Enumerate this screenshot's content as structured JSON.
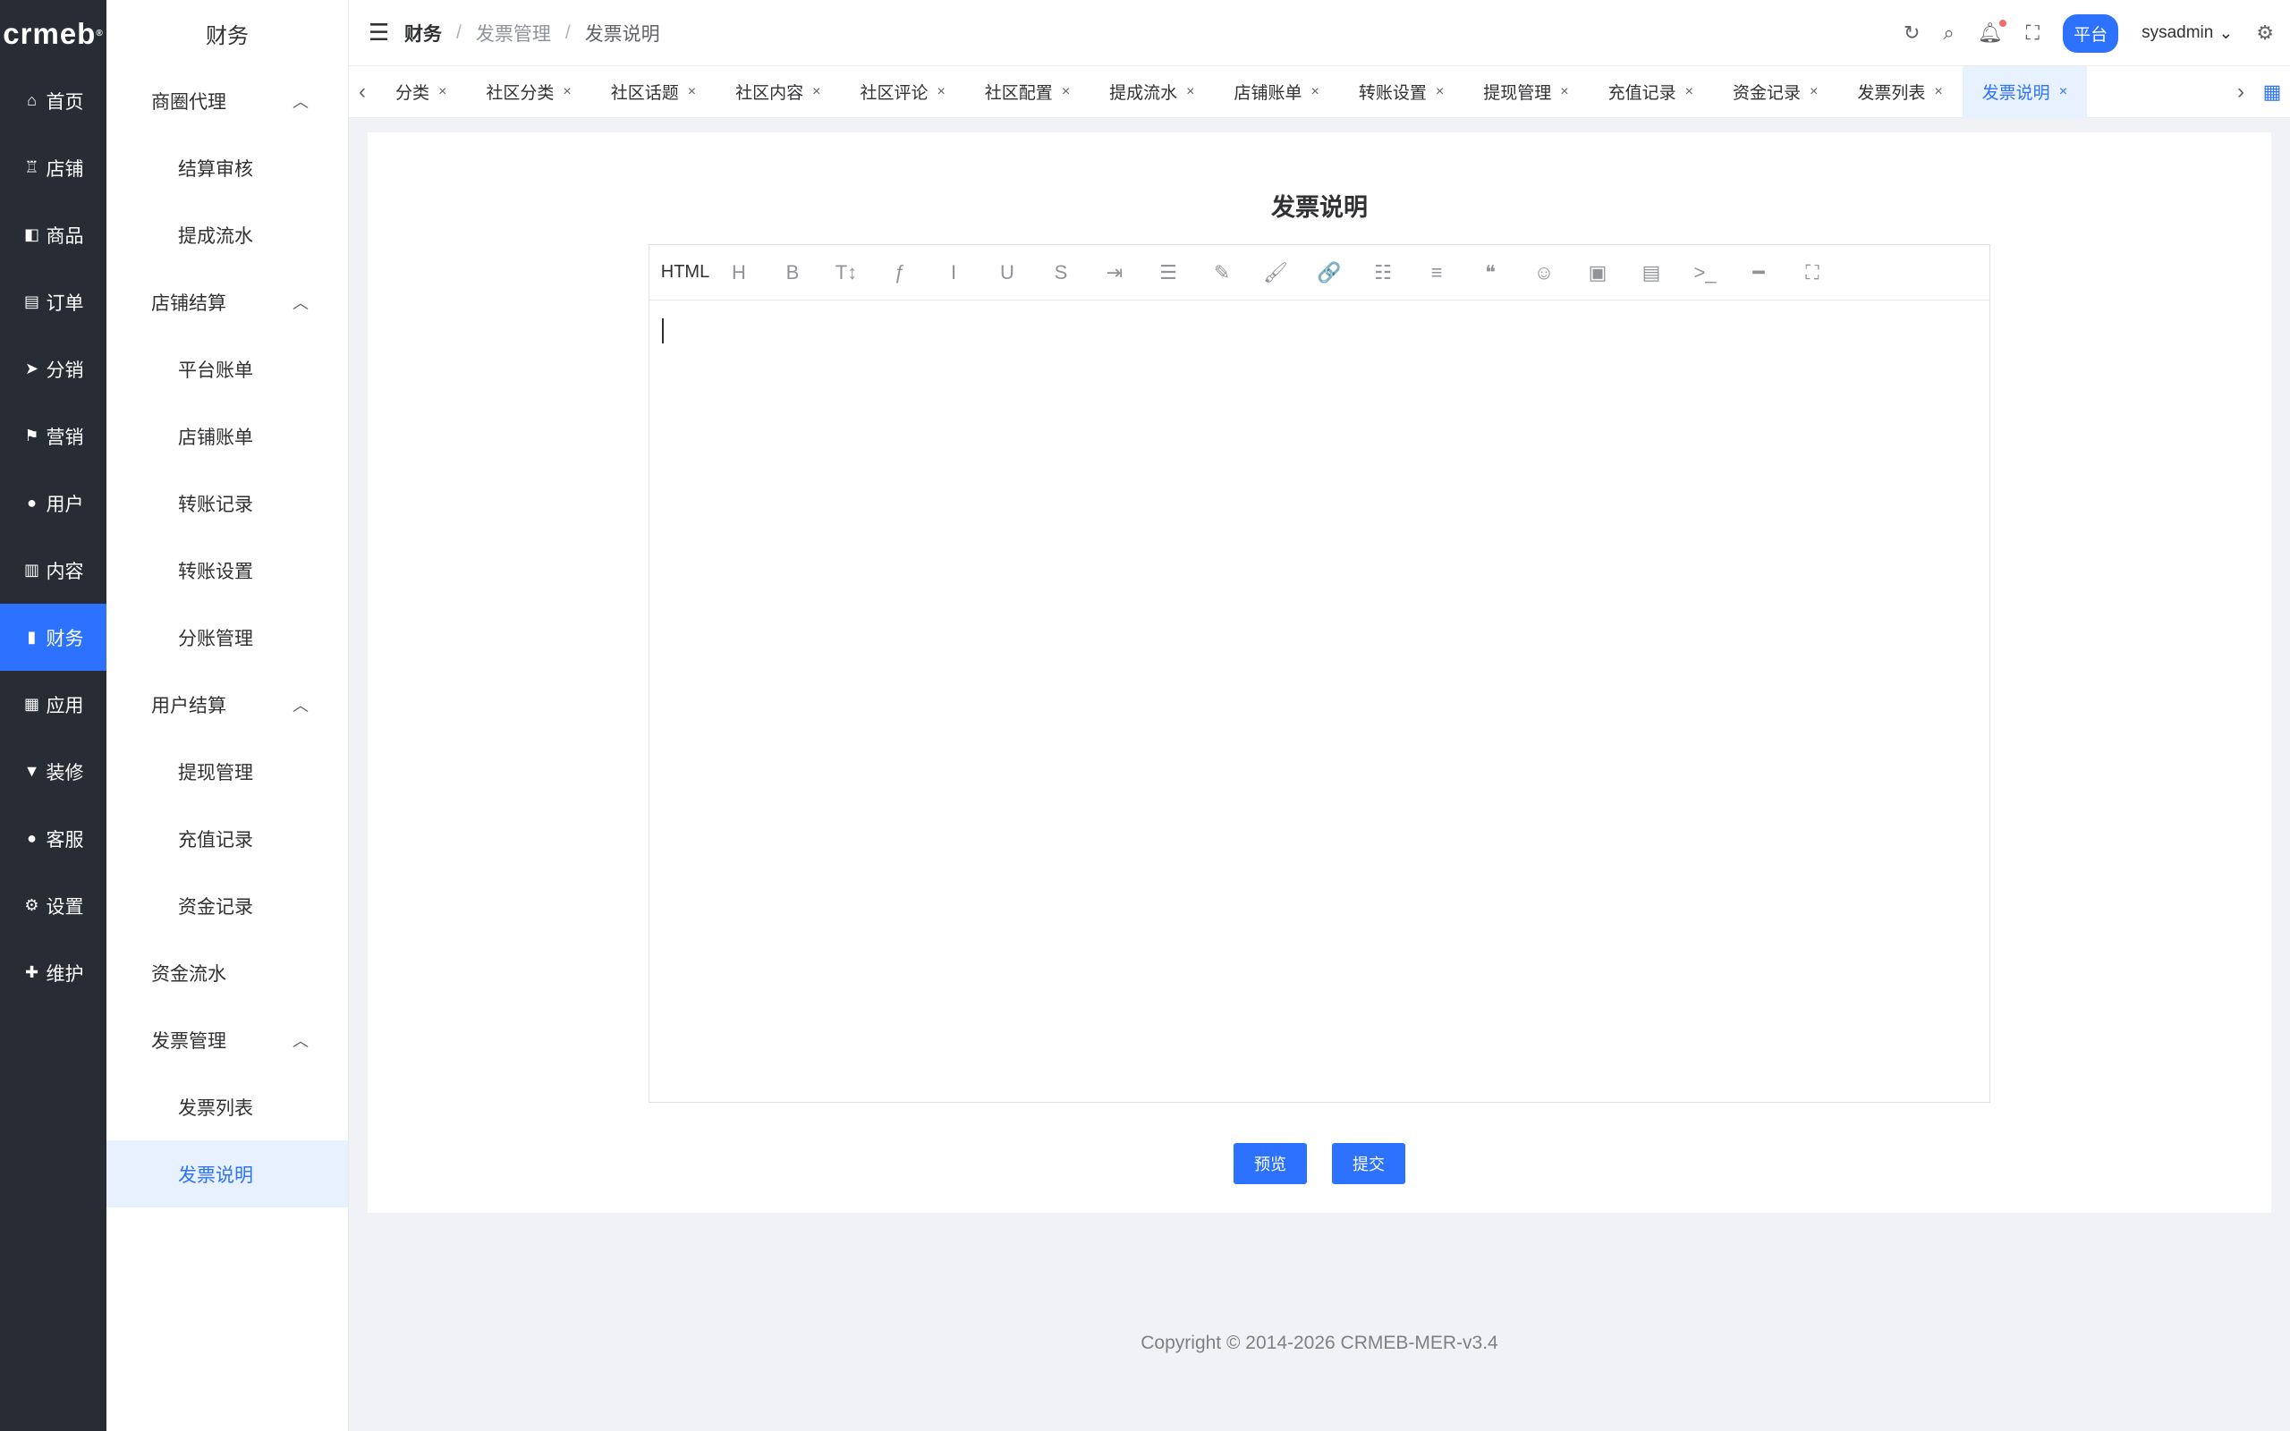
{
  "brand": {
    "logo_text": "crmeb"
  },
  "primary_nav": [
    {
      "label": "首页",
      "icon": "home-icon",
      "glyph": "⌂",
      "active": false
    },
    {
      "label": "店铺",
      "icon": "store-icon",
      "glyph": "♖",
      "active": false
    },
    {
      "label": "商品",
      "icon": "bag-icon",
      "glyph": "◧",
      "active": false
    },
    {
      "label": "订单",
      "icon": "clipboard-icon",
      "glyph": "▤",
      "active": false
    },
    {
      "label": "分销",
      "icon": "send-icon",
      "glyph": "➤",
      "active": false
    },
    {
      "label": "营销",
      "icon": "flag-icon",
      "glyph": "⚑",
      "active": false
    },
    {
      "label": "用户",
      "icon": "user-icon",
      "glyph": "●",
      "active": false
    },
    {
      "label": "内容",
      "icon": "book-icon",
      "glyph": "▥",
      "active": false
    },
    {
      "label": "财务",
      "icon": "chart-icon",
      "glyph": "▮",
      "active": true
    },
    {
      "label": "应用",
      "icon": "grid-icon",
      "glyph": "▦",
      "active": false
    },
    {
      "label": "装修",
      "icon": "brush-icon",
      "glyph": "▼",
      "active": false
    },
    {
      "label": "客服",
      "icon": "headset-icon",
      "glyph": "●",
      "active": false
    },
    {
      "label": "设置",
      "icon": "gear-icon",
      "glyph": "⚙",
      "active": false
    },
    {
      "label": "维护",
      "icon": "wrench-icon",
      "glyph": "✚",
      "active": false
    }
  ],
  "secondary_nav": {
    "title": "财务",
    "g1": {
      "label": "商圈代理"
    },
    "g1_items": [
      "结算审核",
      "提成流水"
    ],
    "g2": {
      "label": "店铺结算"
    },
    "g2_items": [
      "平台账单",
      "店铺账单",
      "转账记录",
      "转账设置",
      "分账管理"
    ],
    "g3": {
      "label": "用户结算"
    },
    "g3_items": [
      "提现管理",
      "充值记录",
      "资金记录"
    ],
    "g4": {
      "label": "资金流水"
    },
    "g5": {
      "label": "发票管理"
    },
    "g5_items": [
      "发票列表",
      "发票说明"
    ]
  },
  "header": {
    "breadcrumb": [
      "财务",
      "发票管理",
      "发票说明"
    ],
    "sep": "/",
    "platform_label": "平台",
    "username": "sysadmin"
  },
  "tabs": [
    {
      "label": "分类",
      "active": false
    },
    {
      "label": "社区分类",
      "active": false
    },
    {
      "label": "社区话题",
      "active": false
    },
    {
      "label": "社区内容",
      "active": false
    },
    {
      "label": "社区评论",
      "active": false
    },
    {
      "label": "社区配置",
      "active": false
    },
    {
      "label": "提成流水",
      "active": false
    },
    {
      "label": "店铺账单",
      "active": false
    },
    {
      "label": "转账设置",
      "active": false
    },
    {
      "label": "提现管理",
      "active": false
    },
    {
      "label": "充值记录",
      "active": false
    },
    {
      "label": "资金记录",
      "active": false
    },
    {
      "label": "发票列表",
      "active": false
    },
    {
      "label": "发票说明",
      "active": true
    }
  ],
  "main": {
    "title": "发票说明",
    "editor": {
      "toolbar": [
        {
          "name": "html-toggle",
          "glyph": "HTML"
        },
        {
          "name": "heading-icon",
          "glyph": "H"
        },
        {
          "name": "bold-icon",
          "glyph": "B"
        },
        {
          "name": "font-size-icon",
          "glyph": "T↕"
        },
        {
          "name": "font-family-icon",
          "glyph": "ƒ"
        },
        {
          "name": "italic-icon",
          "glyph": "I"
        },
        {
          "name": "underline-icon",
          "glyph": "U"
        },
        {
          "name": "strikethrough-icon",
          "glyph": "S"
        },
        {
          "name": "indent-icon",
          "glyph": "⇥"
        },
        {
          "name": "line-height-icon",
          "glyph": "☰"
        },
        {
          "name": "text-color-icon",
          "glyph": "✎"
        },
        {
          "name": "bg-color-icon",
          "glyph": "🖌"
        },
        {
          "name": "link-icon",
          "glyph": "🔗"
        },
        {
          "name": "list-icon",
          "glyph": "☷"
        },
        {
          "name": "align-icon",
          "glyph": "≡"
        },
        {
          "name": "quote-icon",
          "glyph": "❝"
        },
        {
          "name": "emoji-icon",
          "glyph": "☺"
        },
        {
          "name": "image-icon",
          "glyph": "▣"
        },
        {
          "name": "video-icon",
          "glyph": "▤"
        },
        {
          "name": "code-icon",
          "glyph": ">_"
        },
        {
          "name": "divider-icon",
          "glyph": "━"
        },
        {
          "name": "fullscreen-icon",
          "glyph": "⛶"
        }
      ],
      "content": ""
    },
    "preview_label": "预览",
    "submit_label": "提交"
  },
  "footer": {
    "copyright": "Copyright © 2014-2026 CRMEB-MER-v3.4"
  },
  "colors": {
    "accent": "#2d72ff",
    "sidebar_bg": "#282c34",
    "active_bg": "#e8f1ff"
  }
}
